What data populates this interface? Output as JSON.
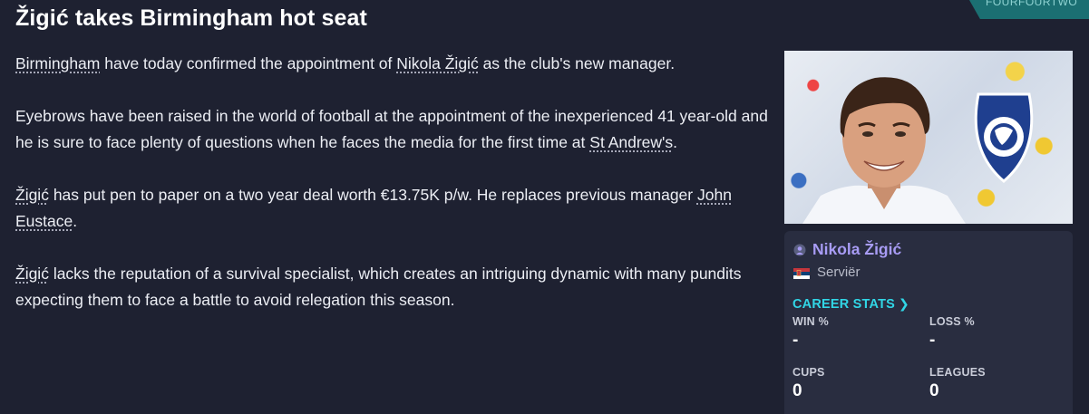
{
  "source_badge": "FOURFOURTWO",
  "headline": "Žigić takes Birmingham hot seat",
  "article": {
    "p1": {
      "club": "Birmingham",
      "t1": " have today confirmed the appointment of ",
      "manager": "Nikola Žigić",
      "t2": " as the club's new manager."
    },
    "p2": {
      "t1": "Eyebrows have been raised in the world of football at the appointment of the inexperienced 41 year-old and he is sure to face plenty of questions when he faces the media for the first time at ",
      "stadium": "St Andrew's",
      "t2": "."
    },
    "p3": {
      "manager": "Žigić",
      "t1": " has put pen to paper on a two year deal worth €13.75K p/w. He replaces previous manager ",
      "previous": "John Eustace",
      "t2": "."
    },
    "p4": {
      "manager": "Žigić",
      "t1": " lacks the reputation of a survival specialist, which creates an intriguing dynamic with many pundits expecting them to face a battle to avoid relegation this season."
    }
  },
  "card": {
    "crest_text": "BIRMINGHAM CITY FOOTBALL CLUB 1875",
    "name": "Nikola Žigić",
    "nation": "Serviër",
    "flag_icon": "serbia-flag-icon",
    "career_stats_label": "CAREER STATS",
    "stats": {
      "win_label": "WIN %",
      "win_value": "-",
      "loss_label": "LOSS %",
      "loss_value": "-",
      "cups_label": "CUPS",
      "cups_value": "0",
      "leagues_label": "LEAGUES",
      "leagues_value": "0"
    }
  },
  "colors": {
    "background": "#1e2131",
    "card": "#292d40",
    "accent_link": "#31d6e6",
    "name": "#a89cf5",
    "badge": "#1b6f72"
  }
}
